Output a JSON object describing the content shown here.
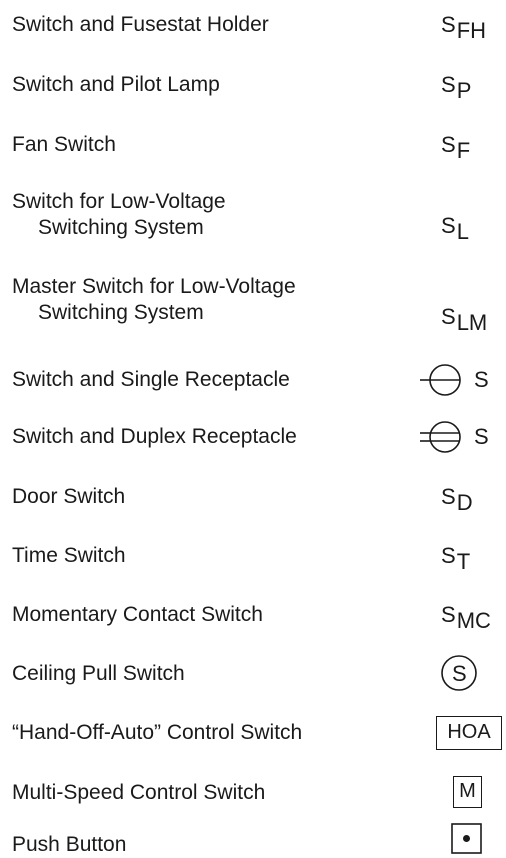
{
  "rows": [
    {
      "label": "Switch and Fusestat Holder",
      "symbol_main": "S",
      "symbol_sub": "FH"
    },
    {
      "label": "Switch and Pilot Lamp",
      "symbol_main": "S",
      "symbol_sub": "P"
    },
    {
      "label": "Fan Switch",
      "symbol_main": "S",
      "symbol_sub": "F"
    },
    {
      "label_line1": "Switch for Low-Voltage",
      "label_line2": "Switching System",
      "symbol_main": "S",
      "symbol_sub": "L"
    },
    {
      "label_line1": "Master Switch for Low-Voltage",
      "label_line2": "Switching System",
      "symbol_main": "S",
      "symbol_sub": "LM"
    },
    {
      "label": "Switch and Single Receptacle",
      "symbol_letter": "S",
      "symbol_icon": "single-receptacle-icon"
    },
    {
      "label": "Switch and Duplex Receptacle",
      "symbol_letter": "S",
      "symbol_icon": "duplex-receptacle-icon"
    },
    {
      "label": "Door Switch",
      "symbol_main": "S",
      "symbol_sub": "D"
    },
    {
      "label": "Time Switch",
      "symbol_main": "S",
      "symbol_sub": "T"
    },
    {
      "label": "Momentary Contact Switch",
      "symbol_main": "S",
      "symbol_sub": "MC"
    },
    {
      "label": "Ceiling Pull Switch",
      "symbol_letter": "S",
      "symbol_icon": "circled-s-icon"
    },
    {
      "label": "“Hand-Off-Auto” Control Switch",
      "symbol_box": "HOA"
    },
    {
      "label": "Multi-Speed Control Switch",
      "symbol_box": "M"
    },
    {
      "label": "Push Button",
      "symbol_icon": "boxed-dot-icon"
    }
  ],
  "colors": {
    "text": "#1a1a1a",
    "background": "#ffffff"
  }
}
